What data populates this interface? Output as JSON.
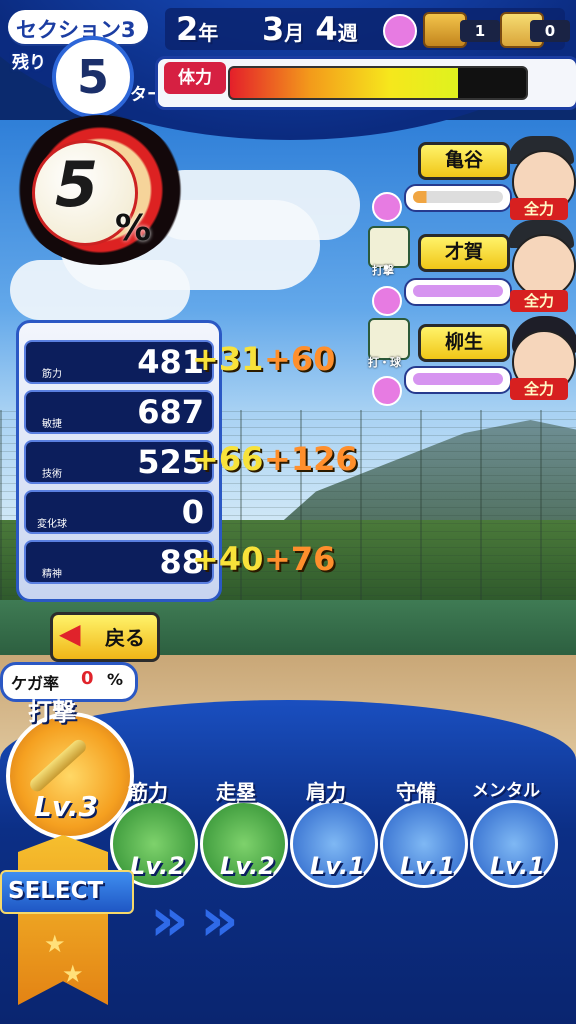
{
  "header": {
    "section_label": "セクション3",
    "remaining_label": "残り",
    "turns_left": "5",
    "turn_unit": "ターン",
    "year": "2",
    "year_unit": "年",
    "month": "3",
    "month_unit": "月",
    "week": "4",
    "week_unit": "週",
    "chest_gold_count": "1",
    "chest_silver_count": "0",
    "stamina_label": "体力",
    "stamina_level": 0.77
  },
  "chance": {
    "value": "5",
    "unit": "%"
  },
  "teammates": [
    {
      "name": "亀谷",
      "skill_caption": "",
      "status": "全力"
    },
    {
      "name": "才賀",
      "skill_caption": "打撃",
      "status": "全力"
    },
    {
      "name": "柳生",
      "skill_caption": "打・球",
      "status": "全力"
    }
  ],
  "stats": [
    {
      "icon": "dumbbell-icon",
      "caption": "筋力",
      "value": "481",
      "bonus1": "+31",
      "bonus2": "+60"
    },
    {
      "icon": "shoe-icon",
      "caption": "敏捷",
      "value": "687",
      "bonus1": "",
      "bonus2": ""
    },
    {
      "icon": "bat-icon",
      "caption": "技術",
      "value": "525",
      "bonus1": "+66",
      "bonus2": "+126"
    },
    {
      "icon": "pitch-icon",
      "caption": "変化球",
      "value": "0",
      "bonus1": "",
      "bonus2": ""
    },
    {
      "icon": "spirit-icon",
      "caption": "精神",
      "value": "88",
      "bonus1": "+40",
      "bonus2": "+76"
    }
  ],
  "back_button": {
    "label": "戻る"
  },
  "injury": {
    "label": "ケガ率",
    "value": "0",
    "unit": "%"
  },
  "practice": {
    "selected": {
      "title": "打撃",
      "level": "Lv.3"
    },
    "options": [
      {
        "title": "筋力",
        "level": "Lv.2",
        "icon": "dumbbell-icon"
      },
      {
        "title": "走塁",
        "level": "Lv.2",
        "icon": "base-icon"
      },
      {
        "title": "肩力",
        "level": "Lv.1",
        "icon": "ball-icon"
      },
      {
        "title": "守備",
        "level": "Lv.1",
        "icon": "glove-icon"
      },
      {
        "title": "メンタル",
        "level": "Lv.1",
        "icon": "sparkle-icon"
      }
    ],
    "select_label": "SELECT"
  },
  "colors": {
    "accent": "#1b3da2",
    "stamina_start": "#e4202a",
    "stamina_end": "#dff21e",
    "bonus1": "#f8e23a",
    "bonus2": "#ff8f2c"
  }
}
